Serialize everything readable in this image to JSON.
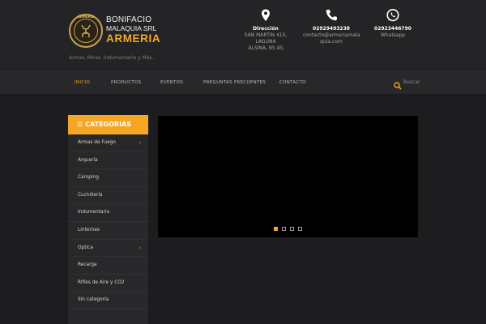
{
  "brand": {
    "line1": "BONIFACIO",
    "line2": "MALAQUIA SRL",
    "line3": "ARMERIA",
    "seal_text": "ARMERIA",
    "tagline": "Armas, Miras, Indumentaria y Más.."
  },
  "contacts": [
    {
      "icon": "map-pin-icon",
      "title": "Dirección",
      "lines": [
        "SAN MARTIN 410, LAGUNA",
        "ALSINA, BS AS"
      ]
    },
    {
      "icon": "phone-icon",
      "title": "02929493238",
      "lines": [
        "contacto@armeriamala",
        "quia.com"
      ]
    },
    {
      "icon": "whatsapp-icon",
      "title": "02923446790",
      "lines": [
        "Whatsapp"
      ]
    }
  ],
  "nav": {
    "items": [
      "INICIO",
      "PRODUCTOS",
      "EVENTOS",
      "PREGUNTAS FRECUENTES",
      "CONTACTO"
    ],
    "active": "INICIO",
    "search_placeholder": "Buscar"
  },
  "categories": {
    "heading": "CATEGORIAS",
    "items": [
      {
        "label": "Armas de Fuego",
        "has_children": true
      },
      {
        "label": "Arquería",
        "has_children": false
      },
      {
        "label": "Camping",
        "has_children": false
      },
      {
        "label": "Cuchillería",
        "has_children": false
      },
      {
        "label": "Indumentaria",
        "has_children": false
      },
      {
        "label": "Linternas",
        "has_children": false
      },
      {
        "label": "Optica",
        "has_children": true
      },
      {
        "label": "Recarga",
        "has_children": false
      },
      {
        "label": "Rifles de Aire y CO2",
        "has_children": false
      },
      {
        "label": "Sin categoría",
        "has_children": false
      }
    ]
  },
  "slider": {
    "slide_count": 4,
    "active_slide": 1
  },
  "colors": {
    "accent": "#f5a623",
    "background": "#1d1d1f",
    "header": "#242426"
  }
}
